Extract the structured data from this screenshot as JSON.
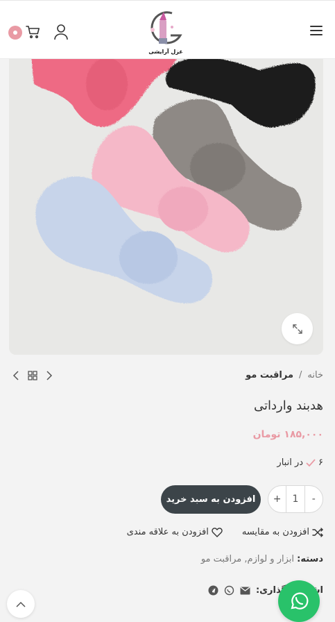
{
  "header": {
    "logo_text": "غزل آرایشی",
    "cart_count_icon": "cart-badge-dot",
    "menu_icon": "hamburger-icon"
  },
  "breadcrumb": {
    "home": "خانه",
    "separator": "/",
    "current": "مراقبت مو"
  },
  "product": {
    "title": "هدبند وارداتی",
    "price": "۱۸۵,۰۰۰ تومان",
    "stock_count": "۶",
    "stock_label": "در انبار",
    "quantity": "1",
    "qty_minus": "-",
    "qty_plus": "+",
    "add_to_cart": "افزودن به سبد خرید",
    "compare": "افزودن به مقایسه",
    "wishlist": "افزودن به علاقه مندی",
    "categories_label": "دسته:",
    "categories_value": "ابزار و لوازم, مراقبت مو",
    "share_label": "اشتراک گذاری:"
  },
  "colors": {
    "accent": "#e99aa4",
    "button": "#3c4449",
    "whatsapp": "#29c26a"
  }
}
